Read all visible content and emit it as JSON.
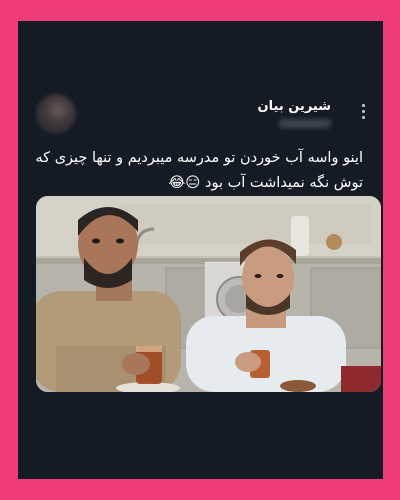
{
  "page": {
    "background": "#f03c78",
    "card_background": "#151b24"
  },
  "tweet": {
    "author_name": "شیرین بیان",
    "text": "اینو واسه آب خوردن تو مدرسه میبردیم و تنها چیزی که توش نگه نمیداشت آب بود 😑😂",
    "media_icon": "movie-still-two-men-holding-tea-glasses"
  }
}
